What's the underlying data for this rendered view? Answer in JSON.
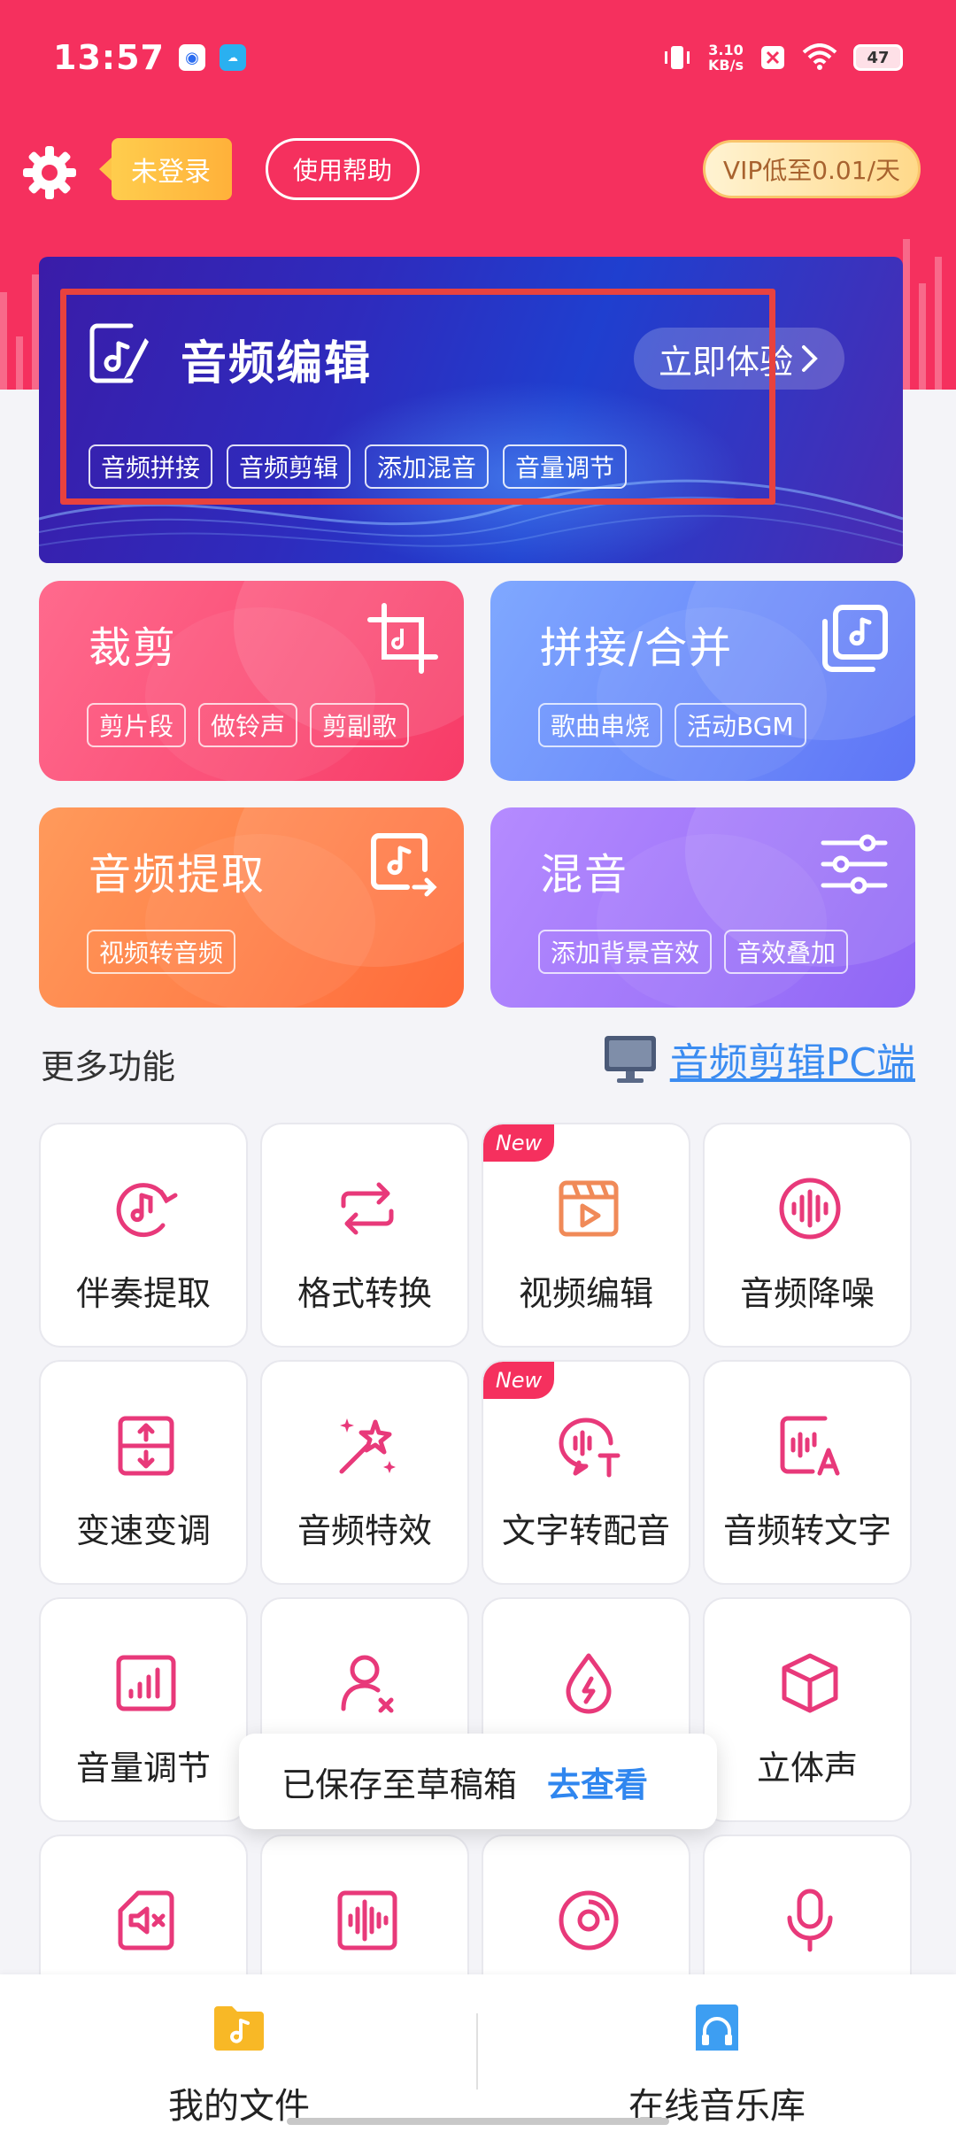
{
  "status_bar": {
    "time": "13:57",
    "net_speed_value": "3.10",
    "net_speed_unit": "KB/s",
    "battery": "47"
  },
  "header": {
    "login_badge": "未登录",
    "help_button": "使用帮助",
    "vip_button": "VIP低至0.01/天"
  },
  "banner": {
    "title": "音频编辑",
    "try_button": "立即体验",
    "tags": [
      "音频拼接",
      "音频剪辑",
      "添加混音",
      "音量调节"
    ]
  },
  "features": {
    "cut": {
      "title": "裁剪",
      "tags": [
        "剪片段",
        "做铃声",
        "剪副歌"
      ]
    },
    "join": {
      "title": "拼接/合并",
      "tags": [
        "歌曲串烧",
        "活动BGM"
      ]
    },
    "extract": {
      "title": "音频提取",
      "tags": [
        "视频转音频"
      ]
    },
    "mix": {
      "title": "混音",
      "tags": [
        "添加背景音效",
        "音效叠加"
      ]
    }
  },
  "more": {
    "title": "更多功能",
    "pc_link": "音频剪辑PC端"
  },
  "tools": {
    "new_badge": "New",
    "items": [
      {
        "label": "伴奏提取",
        "icon": "accompaniment-icon"
      },
      {
        "label": "格式转换",
        "icon": "convert-icon"
      },
      {
        "label": "视频编辑",
        "icon": "video-edit-icon",
        "is_new": true
      },
      {
        "label": "音频降噪",
        "icon": "denoise-icon"
      },
      {
        "label": "变速变调",
        "icon": "speed-pitch-icon"
      },
      {
        "label": "音频特效",
        "icon": "magic-wand-icon"
      },
      {
        "label": "文字转配音",
        "icon": "tts-icon",
        "is_new": true
      },
      {
        "label": "音频转文字",
        "icon": "stt-icon"
      },
      {
        "label": "音量调节",
        "icon": "volume-bars-icon"
      },
      {
        "label": "",
        "icon": "user-remove-icon"
      },
      {
        "label": "",
        "icon": "drop-icon"
      },
      {
        "label": "立体声",
        "icon": "cube-icon"
      },
      {
        "label": "",
        "icon": "mute-file-icon"
      },
      {
        "label": "",
        "icon": "wave-file-icon"
      },
      {
        "label": "",
        "icon": "disc-icon"
      },
      {
        "label": "",
        "icon": "microphone-icon"
      }
    ]
  },
  "toast": {
    "text": "已保存至草稿箱",
    "link": "去查看"
  },
  "bottom_nav": {
    "files": "我的文件",
    "library": "在线音乐库"
  },
  "colors": {
    "brand": "#f5305e",
    "link": "#2f86ef",
    "highlight": "#e8423e"
  }
}
